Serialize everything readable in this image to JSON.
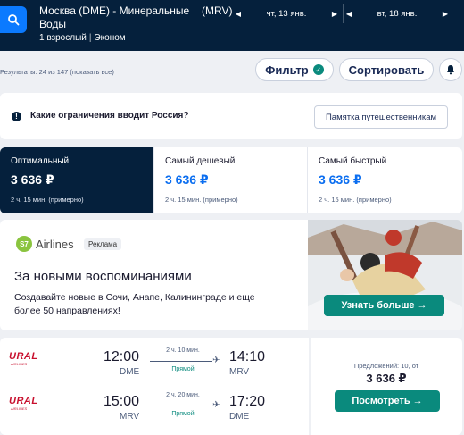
{
  "header": {
    "route": "Москва (DME) - Минеральные Воды",
    "dest_code": "(MRV)",
    "passengers": "1 взрослый",
    "cabin": "Эконом",
    "date_out": "чт, 13 янв.",
    "date_back": "вт, 18 янв."
  },
  "toolbar": {
    "results": "Результаты: 24 из 147 (показать все)",
    "filter_label": "Фильтр",
    "sort_label": "Сортировать"
  },
  "info": {
    "question": "Какие ограничения вводит Россия?",
    "memo_button": "Памятка путешественникам"
  },
  "tabs": [
    {
      "label": "Оптимальный",
      "price": "3 636 ₽",
      "duration": "2 ч. 15 мин. (примерно)"
    },
    {
      "label": "Самый дешевый",
      "price": "3 636 ₽",
      "duration": "2 ч. 15 мин. (примерно)"
    },
    {
      "label": "Самый быстрый",
      "price": "3 636 ₽",
      "duration": "2 ч. 15 мин. (примерно)"
    }
  ],
  "ad": {
    "brand": "Airlines",
    "brand_mark": "S7",
    "tag": "Реклама",
    "title": "За новыми воспоминаниями",
    "body": "Создавайте новые в Сочи, Анапе, Калининграде и еще более 50 направлениях!",
    "cta": "Узнать больше →"
  },
  "flight": {
    "airline": "URAL",
    "airline_sub": "AIRLINES",
    "legs": [
      {
        "dep_time": "12:00",
        "dep_code": "DME",
        "duration": "2 ч. 10 мин.",
        "stops": "Прямой",
        "arr_time": "14:10",
        "arr_code": "MRV"
      },
      {
        "dep_time": "15:00",
        "dep_code": "MRV",
        "duration": "2 ч. 20 мин.",
        "stops": "Прямой",
        "arr_time": "17:20",
        "arr_code": "DME"
      }
    ],
    "offers": "Предложений: 10, от",
    "price": "3 636 ₽",
    "cta": "Посмотреть →"
  },
  "icons": [
    "search-icon",
    "chevron-left-icon",
    "chevron-right-icon",
    "check-icon",
    "bell-icon",
    "info-icon",
    "plane-icon"
  ],
  "colors": {
    "header_bg": "#05203c",
    "accent_blue": "#0b6ef0",
    "cta_green": "#0a8a7d"
  }
}
